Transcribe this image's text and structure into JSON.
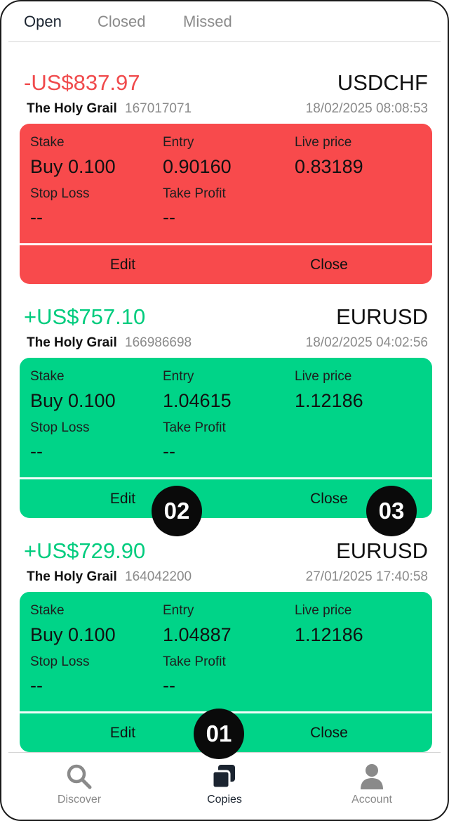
{
  "tabs": [
    {
      "label": "Open",
      "active": true
    },
    {
      "label": "Closed",
      "active": false
    },
    {
      "label": "Missed",
      "active": false
    }
  ],
  "trades": [
    {
      "pnl": "-US$837.97",
      "pnl_color": "#f04a4c",
      "symbol": "USDCHF",
      "strategy": "The Holy Grail",
      "id": "167017071",
      "datetime": "18/02/2025 08:08:53",
      "panel_color": "#f84a4c",
      "stake_label": "Stake",
      "stake": "Buy 0.100",
      "entry_label": "Entry",
      "entry": "0.90160",
      "live_label": "Live price",
      "live": "0.83189",
      "sl_label": "Stop Loss",
      "sl": "--",
      "tp_label": "Take Profit",
      "tp": "--",
      "edit_label": "Edit",
      "close_label": "Close"
    },
    {
      "pnl": "+US$757.10",
      "pnl_color": "#00cc7e",
      "symbol": "EURUSD",
      "strategy": "The Holy Grail",
      "id": "166986698",
      "datetime": "18/02/2025 04:02:56",
      "panel_color": "#00d488",
      "stake_label": "Stake",
      "stake": "Buy 0.100",
      "entry_label": "Entry",
      "entry": "1.04615",
      "live_label": "Live price",
      "live": "1.12186",
      "sl_label": "Stop Loss",
      "sl": "--",
      "tp_label": "Take Profit",
      "tp": "--",
      "edit_label": "Edit",
      "close_label": "Close"
    },
    {
      "pnl": "+US$729.90",
      "pnl_color": "#00cc7e",
      "symbol": "EURUSD",
      "strategy": "The Holy Grail",
      "id": "164042200",
      "datetime": "27/01/2025 17:40:58",
      "panel_color": "#00d488",
      "stake_label": "Stake",
      "stake": "Buy 0.100",
      "entry_label": "Entry",
      "entry": "1.04887",
      "live_label": "Live price",
      "live": "1.12186",
      "sl_label": "Stop Loss",
      "sl": "--",
      "tp_label": "Take Profit",
      "tp": "--",
      "edit_label": "Edit",
      "close_label": "Close"
    }
  ],
  "markers": {
    "m01": "01",
    "m02": "02",
    "m03": "03"
  },
  "nav": [
    {
      "label": "Discover",
      "icon": "search-icon",
      "active": false
    },
    {
      "label": "Copies",
      "icon": "copies-icon",
      "active": true
    },
    {
      "label": "Account",
      "icon": "person-icon",
      "active": false
    }
  ],
  "colors": {
    "loss": "#f04a4c",
    "profit": "#00cc7e",
    "loss_panel": "#f84a4c",
    "profit_panel": "#00d488",
    "active_text": "#1b2430",
    "muted_text": "#8a8a8a"
  }
}
